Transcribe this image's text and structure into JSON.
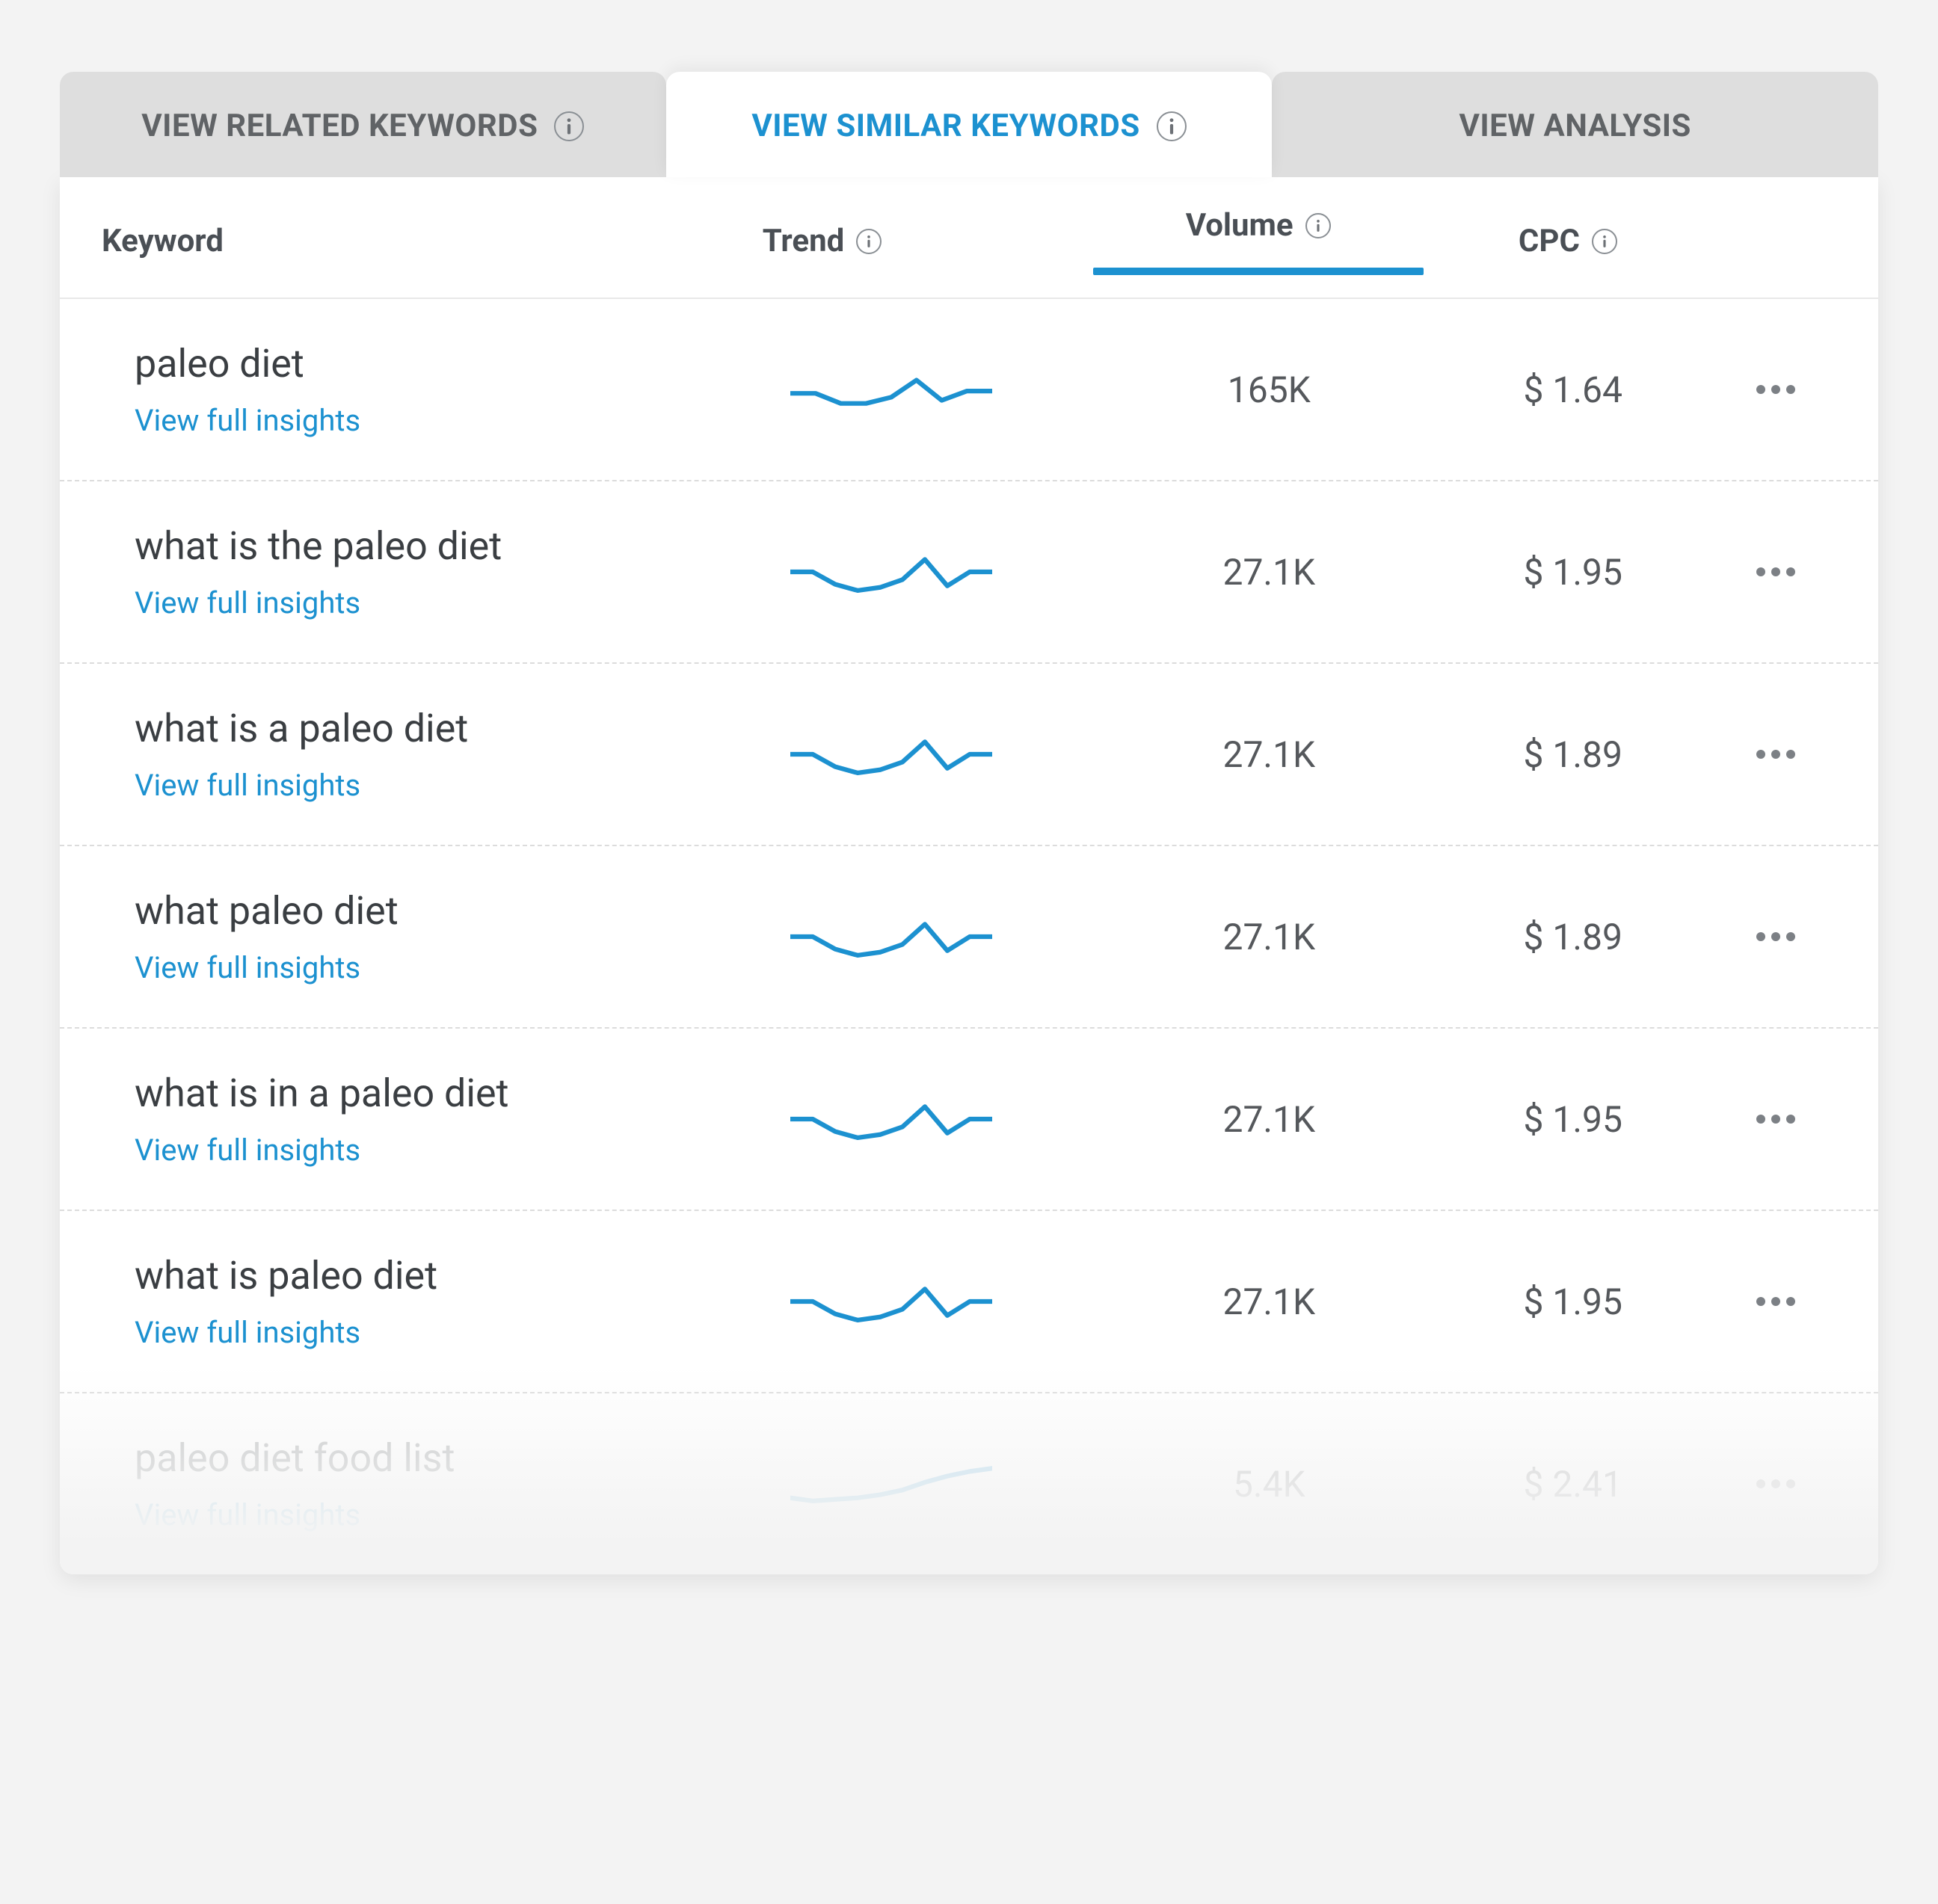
{
  "tabs": [
    {
      "label": "VIEW RELATED KEYWORDS",
      "info": true,
      "active": false
    },
    {
      "label": "VIEW SIMILAR KEYWORDS",
      "info": true,
      "active": true
    },
    {
      "label": "VIEW ANALYSIS",
      "info": false,
      "active": false
    }
  ],
  "columns": {
    "keyword": "Keyword",
    "trend": "Trend",
    "volume": "Volume",
    "cpc": "CPC"
  },
  "sorted_column": "volume",
  "view_link_text": "View full insights",
  "rows": [
    {
      "keyword": "paleo diet",
      "trend": [
        35,
        35,
        48,
        48,
        40,
        18,
        44,
        32,
        32
      ],
      "volume": "165K",
      "cpc": "$ 1.64"
    },
    {
      "keyword": "what is the paleo diet",
      "trend": [
        30,
        30,
        46,
        54,
        50,
        40,
        14,
        48,
        30,
        30
      ],
      "volume": "27.1K",
      "cpc": "$ 1.95"
    },
    {
      "keyword": "what is a paleo diet",
      "trend": [
        30,
        30,
        46,
        54,
        50,
        40,
        14,
        48,
        30,
        30
      ],
      "volume": "27.1K",
      "cpc": "$ 1.89"
    },
    {
      "keyword": "what paleo diet",
      "trend": [
        30,
        30,
        46,
        54,
        50,
        40,
        14,
        48,
        30,
        30
      ],
      "volume": "27.1K",
      "cpc": "$ 1.89"
    },
    {
      "keyword": "what is in a paleo diet",
      "trend": [
        30,
        30,
        46,
        54,
        50,
        40,
        14,
        48,
        30,
        30
      ],
      "volume": "27.1K",
      "cpc": "$ 1.95"
    },
    {
      "keyword": "what is paleo diet",
      "trend": [
        30,
        30,
        46,
        54,
        50,
        40,
        14,
        48,
        30,
        30
      ],
      "volume": "27.1K",
      "cpc": "$ 1.95"
    },
    {
      "keyword": "paleo diet food list",
      "trend": [
        48,
        52,
        50,
        48,
        44,
        38,
        28,
        20,
        14,
        10
      ],
      "volume": "5.4K",
      "cpc": "$ 2.41",
      "faded": true
    }
  ]
}
